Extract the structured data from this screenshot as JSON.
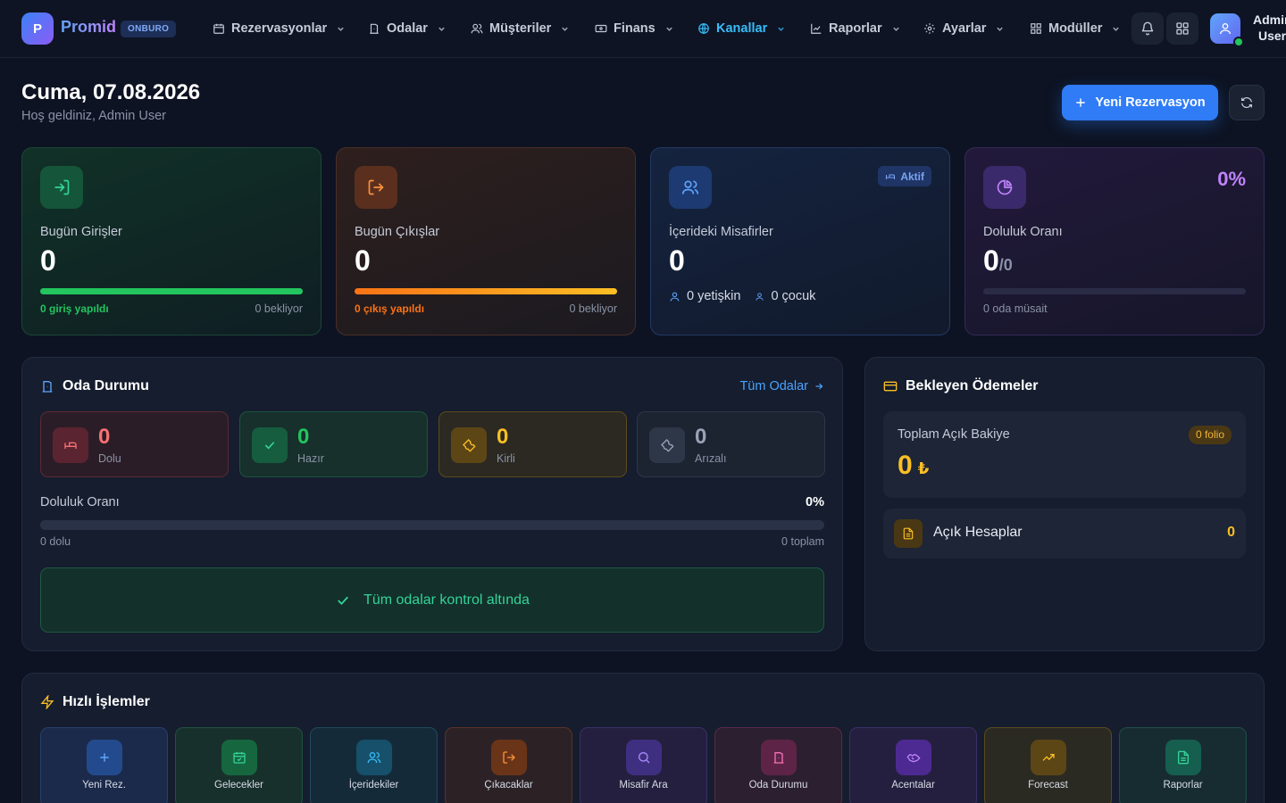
{
  "app": {
    "logo_letter": "P",
    "brand": "Promid",
    "brand_badge": "ONBURO"
  },
  "nav": [
    {
      "label": "Rezervasyonlar",
      "icon": "calendar-icon",
      "active": false
    },
    {
      "label": "Odalar",
      "icon": "door-icon",
      "active": false
    },
    {
      "label": "Müşteriler",
      "icon": "users-icon",
      "active": false
    },
    {
      "label": "Finans",
      "icon": "banknote-icon",
      "active": false
    },
    {
      "label": "Kanallar",
      "icon": "globe-icon",
      "active": true
    },
    {
      "label": "Raporlar",
      "icon": "chart-icon",
      "active": false
    },
    {
      "label": "Ayarlar",
      "icon": "gear-icon",
      "active": false
    },
    {
      "label": "Modüller",
      "icon": "grid-icon",
      "active": false
    }
  ],
  "user": {
    "name": "Admin",
    "role": "User"
  },
  "header": {
    "title": "Cuma, 07.08.2026",
    "subtitle": "Hoş geldiniz, Admin User",
    "new_reservation": "Yeni Rezervasyon"
  },
  "stats": {
    "checkins": {
      "label": "Bugün Girişler",
      "value": "0",
      "done": "0 giriş yapıldı",
      "waiting": "0 bekliyor",
      "progress": 1.0
    },
    "checkouts": {
      "label": "Bugün Çıkışlar",
      "value": "0",
      "done": "0 çıkış yapıldı",
      "waiting": "0 bekliyor",
      "progress": 1.0
    },
    "guests": {
      "label": "İçerideki Misafirler",
      "value": "0",
      "badge": "Aktif",
      "adults": "0 yetişkin",
      "children": "0 çocuk"
    },
    "occupancy": {
      "label": "Doluluk Oranı",
      "value": "0",
      "value_sub": "/0",
      "percent": "0%",
      "available": "0 oda müsait",
      "progress": 0
    }
  },
  "room_status": {
    "title": "Oda Durumu",
    "link": "Tüm Odalar",
    "cards": [
      {
        "value": "0",
        "label": "Dolu"
      },
      {
        "value": "0",
        "label": "Hazır"
      },
      {
        "value": "0",
        "label": "Kirli"
      },
      {
        "value": "0",
        "label": "Arızalı"
      }
    ],
    "occupancy_label": "Doluluk Oranı",
    "occupancy_percent": "0%",
    "occupancy_progress": 0,
    "occupied": "0 dolu",
    "total": "0 toplam",
    "all_ok": "Tüm odalar kontrol altında"
  },
  "payments": {
    "title": "Bekleyen Ödemeler",
    "balance_label": "Toplam Açık Bakiye",
    "folio_badge": "0 folio",
    "balance_value": "0",
    "currency": "₺",
    "accounts_label": "Açık Hesaplar",
    "accounts_value": "0"
  },
  "quick_actions": {
    "title": "Hızlı İşlemler",
    "items": [
      {
        "label": "Yeni Rez.",
        "icon": "plus-icon"
      },
      {
        "label": "Gelecekler",
        "icon": "calendar-check-icon"
      },
      {
        "label": "İçeridekiler",
        "icon": "users-icon"
      },
      {
        "label": "Çıkacaklar",
        "icon": "logout-icon"
      },
      {
        "label": "Misafir Ara",
        "icon": "search-icon"
      },
      {
        "label": "Oda Durumu",
        "icon": "door-icon"
      },
      {
        "label": "Acentalar",
        "icon": "handshake-icon"
      },
      {
        "label": "Forecast",
        "icon": "trending-up-icon"
      },
      {
        "label": "Raporlar",
        "icon": "file-icon"
      }
    ]
  },
  "colors": {
    "accent_blue": "#2f7cf6",
    "active_nav": "#38bdf8",
    "green": "#22c55e",
    "orange": "#f97316",
    "purple": "#c084fc",
    "amber": "#fbbf24",
    "red": "#f87171"
  }
}
